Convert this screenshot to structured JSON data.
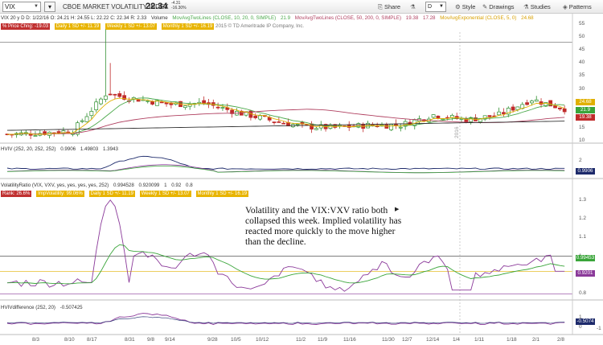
{
  "toolbar": {
    "symbol": "VIX",
    "description": "CBOE MARKET VOLATILITY INDEX",
    "last": "22.34",
    "change": "-4.31",
    "change_pct": "-16.30%",
    "share": "Share",
    "timeframe": "D",
    "style": "Style",
    "drawings": "Drawings",
    "studies": "Studies",
    "patterns": "Patterns"
  },
  "header": {
    "line1": "VIX 20 y D  D: 1/22/16  O: 24.21  H: 24.55  L: 22.22  C: 22.34  R: 2.33",
    "volume": "Volume",
    "ma10": "MovAvgTwoLines (CLOSE, 10, 20, 0, SIMPLE)",
    "ma10_val": "21.9",
    "ma50": "MovAvgTwoLines (CLOSE, 50, 200, 0, SIMPLE)",
    "ma50_val": "19.38",
    "ma50_val2": "17.28",
    "exp": "MovAvgExponential (CLOSE, 5, 0)",
    "exp_val": "24.68"
  },
  "line2": {
    "pct_chg": "% Price Chng: -19.03",
    "daily": "Daily 1 SD +/- 11.19",
    "weekly": "Weekly 1 SD +/- 13.07",
    "monthly": "Monthly 1 SD +/- 16.19",
    "copyright": "2015 © TD Ameritrade IP Company, Inc."
  },
  "price_axis": [
    "55",
    "50",
    "45",
    "40",
    "35",
    "30",
    "25",
    "20",
    "15",
    "10"
  ],
  "price_tags": {
    "exp": "24.68",
    "ma10": "21.9",
    "ma50": "19.38"
  },
  "hviv": {
    "label": "HVIV (252, 20, 252, 252)",
    "v1": "0.9906",
    "v2": "1.49803",
    "v3": "1.3943",
    "axis": [
      "2",
      "1"
    ],
    "tag": "0.9906"
  },
  "volratio": {
    "label": "VolatilityRatio (VIX, VXV, yes, yes, yes, yes, 252)",
    "v1": "0.994528",
    "v2": "0.920099",
    "v3": "1",
    "v4": "0.92",
    "v5": "0.8",
    "line2_rank": "Rank: 26.6%",
    "line2_iv": "ImpVolatility: 99.06%",
    "line2_daily": "Daily 1 SD +/- 11.19",
    "line2_weekly": "Weekly 1 SD +/- 13.07",
    "line2_monthly": "Monthly 1 SD +/- 16.19",
    "axis": [
      "1.3",
      "1.2",
      "1.1",
      "1",
      "0.9",
      "0.8"
    ],
    "tag1": "0.99453",
    "tag2": "0.9201"
  },
  "hvdiff": {
    "label": "HVIVdifference (252, 20)",
    "v1": "-0.507425",
    "axis": [
      "1",
      "0",
      "-1"
    ],
    "tag": "-0.5074"
  },
  "annotation": "Volatility and the VIX:VXV ratio both collapsed this week.  Implied volatility has reacted more quickly to the move higher than the decline.",
  "dates": [
    "8/3",
    "8/10",
    "8/17",
    "8/31",
    "9/8",
    "9/14",
    "9/28",
    "10/5",
    "10/12",
    "11/2",
    "11/9",
    "11/16",
    "11/30",
    "12/7",
    "12/14",
    "1/4",
    "1/11",
    "1/18",
    "2/1",
    "2/8"
  ],
  "year_label": "2016",
  "colors": {
    "up": "#2f8f2f",
    "down": "#c02b2b",
    "ma10": "#4aa84a",
    "ma50": "#b04060",
    "exp": "#e0b000",
    "purple": "#8b3a9a",
    "green_line": "#3aa53a",
    "navy": "#1d2a6b"
  },
  "chart_data": {
    "type": "candlestick",
    "title": "CBOE MARKET VOLATILITY INDEX",
    "ylim": [
      10,
      55
    ],
    "x_dates": [
      "8/3",
      "8/10",
      "8/17",
      "8/31",
      "9/8",
      "9/14",
      "9/28",
      "10/5",
      "10/12",
      "11/2",
      "11/9",
      "11/16",
      "11/30",
      "12/7",
      "12/14",
      "1/4",
      "1/11",
      "1/18"
    ],
    "approx_close": [
      12.5,
      13,
      13.8,
      28,
      26,
      24,
      24.5,
      21,
      18,
      15.5,
      15,
      16,
      16,
      20,
      18,
      20,
      26,
      22.3
    ]
  }
}
